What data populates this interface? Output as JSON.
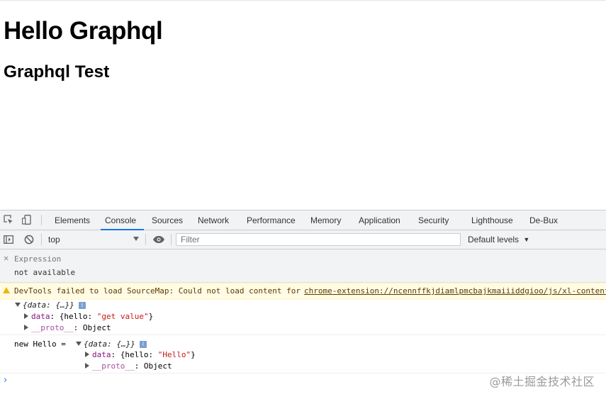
{
  "page": {
    "h1": "Hello Graphql",
    "h2": "Graphql Test"
  },
  "devtools": {
    "tabs": [
      "Elements",
      "Console",
      "Sources",
      "Network",
      "Performance",
      "Memory",
      "Application",
      "Security",
      "Lighthouse",
      "De-Bux"
    ],
    "active_tab": "Console",
    "toolbar": {
      "context": "top",
      "filter_placeholder": "Filter",
      "levels": "Default levels"
    },
    "expression": {
      "label": "Expression",
      "value": "not available"
    },
    "warning": {
      "message": "DevTools failed to load SourceMap: Could not load content for",
      "link": "chrome-extension://ncennffkjdiamlpmcbajkmaiiiddgioo/js/xl-content"
    },
    "log1": {
      "summary": "{data: {…}}",
      "data_key": "data",
      "data_value_prefix": "{hello: ",
      "data_value_str": "\"get value\"",
      "data_value_suffix": "}",
      "proto_key": "__proto__",
      "proto_value": "Object"
    },
    "log2": {
      "prefix": "new Hello = ",
      "summary": "{data: {…}}",
      "data_key": "data",
      "data_value_prefix": "{hello: ",
      "data_value_str": "\"Hello\"",
      "data_value_suffix": "}",
      "proto_key": "__proto__",
      "proto_value": "Object"
    },
    "prompt": "›"
  },
  "watermark": "@稀土掘金技术社区",
  "colors": {
    "accent": "#1a73e8",
    "warning_bg": "#fffbe5",
    "warning_icon": "#f5b400"
  }
}
